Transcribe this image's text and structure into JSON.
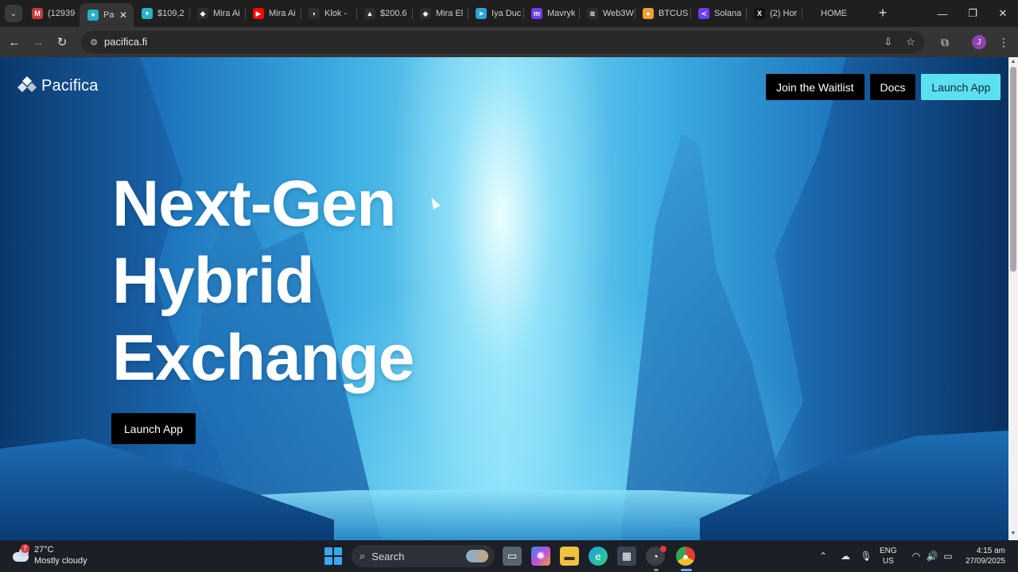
{
  "browser": {
    "tabs": [
      {
        "label": "(12939",
        "favicon": "gmail-icon",
        "color": "#c53b3b",
        "glyph": "M"
      },
      {
        "label": "Pa",
        "favicon": "pacifica-icon",
        "color": "#2ab0c8",
        "glyph": "✦",
        "active": true
      },
      {
        "label": "$109,2",
        "favicon": "pacifica-icon",
        "color": "#2ab0c8",
        "glyph": "✦"
      },
      {
        "label": "Mira Ai",
        "favicon": "mira-icon",
        "color": "#2d2d2d",
        "glyph": "◆"
      },
      {
        "label": "Mira Ai",
        "favicon": "youtube-icon",
        "color": "#ff0000",
        "glyph": "▶"
      },
      {
        "label": "Klok - ",
        "favicon": "klok-icon",
        "color": "#2d2d2d",
        "glyph": "◗"
      },
      {
        "label": "$200.6",
        "favicon": "delta-icon",
        "color": "#2d2d2d",
        "glyph": "▲"
      },
      {
        "label": "Mira El",
        "favicon": "mira-icon",
        "color": "#2d2d2d",
        "glyph": "◆"
      },
      {
        "label": "Iya Duc",
        "favicon": "telegram-icon",
        "color": "#2aa3dd",
        "glyph": "➤"
      },
      {
        "label": "Mavryk",
        "favicon": "mavryk-icon",
        "color": "#6e3ef0",
        "glyph": "m"
      },
      {
        "label": "Web3W",
        "favicon": "web3-icon",
        "color": "#2d2d2d",
        "glyph": "≋"
      },
      {
        "label": "BTCUS",
        "favicon": "btc-icon",
        "color": "#f0a030",
        "glyph": "●"
      },
      {
        "label": "Solana",
        "favicon": "solana-icon",
        "color": "#6a3ef0",
        "glyph": "≺"
      },
      {
        "label": "(2) Hor",
        "favicon": "x-icon",
        "color": "#111111",
        "glyph": "X"
      },
      {
        "label": "HOME",
        "favicon": "",
        "color": "#1f1f1f",
        "glyph": ""
      }
    ],
    "url": "pacifica.fi",
    "profile_initial": "J"
  },
  "page": {
    "brand": "Pacifica",
    "nav": {
      "waitlist": "Join the Waitlist",
      "docs": "Docs",
      "launch": "Launch App"
    },
    "hero": {
      "line1": "Next-Gen",
      "line2": "Hybrid",
      "line3": "Exchange",
      "cta": "Launch App"
    },
    "colors": {
      "accent": "#5ce0f0",
      "button_dark": "#000000"
    }
  },
  "taskbar": {
    "weather_temp": "27°C",
    "weather_desc": "Mostly cloudy",
    "weather_badge": "7",
    "search_label": "Search",
    "lang_line1": "ENG",
    "lang_line2": "US",
    "time": "4:15 am",
    "date": "27/09/2025"
  }
}
